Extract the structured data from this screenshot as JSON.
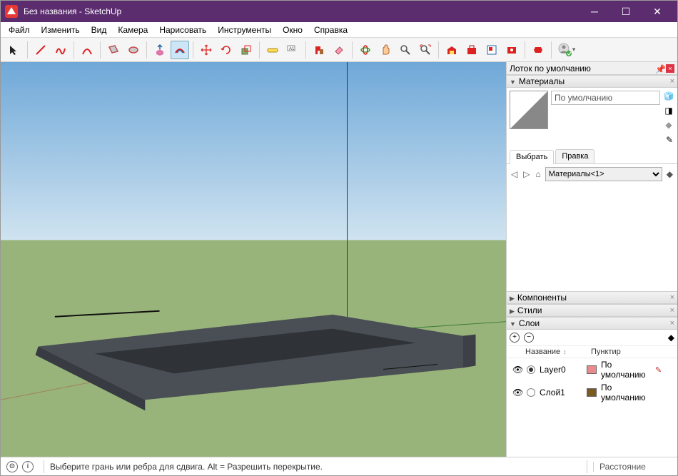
{
  "titlebar": {
    "text": "Без названия - SketchUp"
  },
  "menu": [
    "Файл",
    "Изменить",
    "Вид",
    "Камера",
    "Нарисовать",
    "Инструменты",
    "Окно",
    "Справка"
  ],
  "side": {
    "tray_title": "Лоток по умолчанию",
    "materials": {
      "title": "Материалы",
      "current": "По умолчанию",
      "tabs": {
        "select": "Выбрать",
        "edit": "Правка"
      },
      "library": "Материалы<1>"
    },
    "components": {
      "title": "Компоненты"
    },
    "styles": {
      "title": "Стили"
    },
    "layers": {
      "title": "Слои",
      "col_name": "Название",
      "col_dash": "Пунктир",
      "rows": [
        {
          "name": "Layer0",
          "color": "#e98b8b",
          "dash": "По умолчанию",
          "active": true
        },
        {
          "name": "Слой1",
          "color": "#7a5a20",
          "dash": "По умолчанию",
          "active": false
        }
      ]
    }
  },
  "status": {
    "hint": "Выберите грань или ребра для сдвига. Alt = Разрешить перекрытие.",
    "distance_label": "Расстояние"
  }
}
